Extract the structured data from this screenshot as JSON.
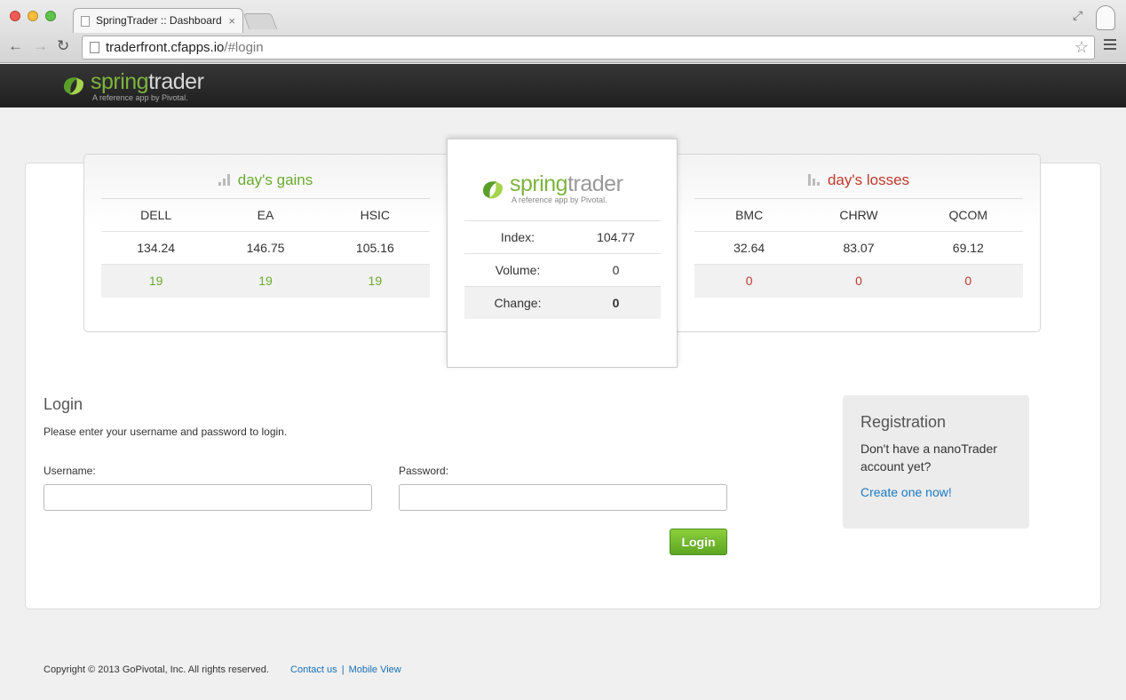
{
  "browser": {
    "tab_title": "SpringTrader :: Dashboard",
    "url_host": "traderfront.cfapps.io",
    "url_path": "/#login"
  },
  "header": {
    "logo_spring": "spring",
    "logo_trader": "trader",
    "logo_sub": "A reference app by Pivotal."
  },
  "gains": {
    "title": "day's gains",
    "symbols": [
      "DELL",
      "EA",
      "HSIC"
    ],
    "prices": [
      "134.24",
      "146.75",
      "105.16"
    ],
    "volumes": [
      "19",
      "19",
      "19"
    ]
  },
  "losses": {
    "title": "day's losses",
    "symbols": [
      "BMC",
      "CHRW",
      "QCOM"
    ],
    "prices": [
      "32.64",
      "83.07",
      "69.12"
    ],
    "volumes": [
      "0",
      "0",
      "0"
    ]
  },
  "market": {
    "index_label": "Index:",
    "index_value": "104.77",
    "volume_label": "Volume:",
    "volume_value": "0",
    "change_label": "Change:",
    "change_value": "0"
  },
  "login": {
    "title": "Login",
    "prompt": "Please enter your username and password to login.",
    "username_label": "Username:",
    "password_label": "Password:",
    "username_value": "",
    "password_value": "",
    "button": "Login"
  },
  "registration": {
    "title": "Registration",
    "text": "Don't have a nanoTrader account yet?",
    "link": "Create one now!"
  },
  "footer": {
    "copyright": "Copyright © 2013 GoPivotal, Inc. All rights reserved.",
    "contact": "Contact us",
    "separator": "|",
    "mobile": "Mobile View"
  },
  "colors": {
    "gain_green": "#6aaa2e",
    "loss_red": "#c0392b",
    "link_blue": "#1a7ac4",
    "button_green": "#6fb92a"
  }
}
